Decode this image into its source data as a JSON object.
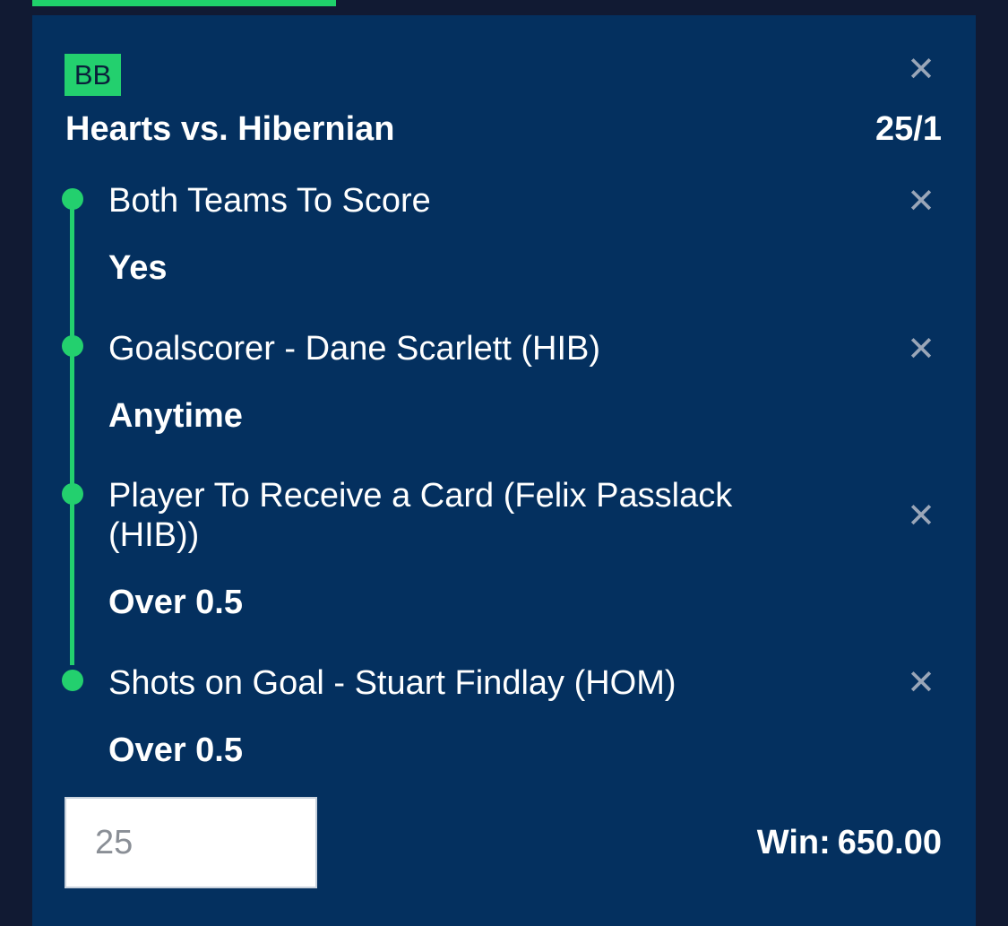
{
  "badge": "BB",
  "match": {
    "title": "Hearts vs. Hibernian",
    "odds": "25/1"
  },
  "legs": [
    {
      "market": "Both Teams To Score",
      "selection": "Yes"
    },
    {
      "market": "Goalscorer - Dane Scarlett (HIB)",
      "selection": "Anytime"
    },
    {
      "market": "Player To Receive a Card (Felix Passlack (HIB))",
      "selection": "Over 0.5"
    },
    {
      "market": "Shots on Goal - Stuart Findlay (HOM)",
      "selection": "Over 0.5"
    }
  ],
  "stake": {
    "value": "25"
  },
  "win": {
    "label": "Win:",
    "amount": "650.00"
  },
  "icons": {
    "close": "close-icon"
  },
  "colors": {
    "accent": "#23d06e",
    "card_bg": "#04305f",
    "page_bg": "#111a33"
  }
}
